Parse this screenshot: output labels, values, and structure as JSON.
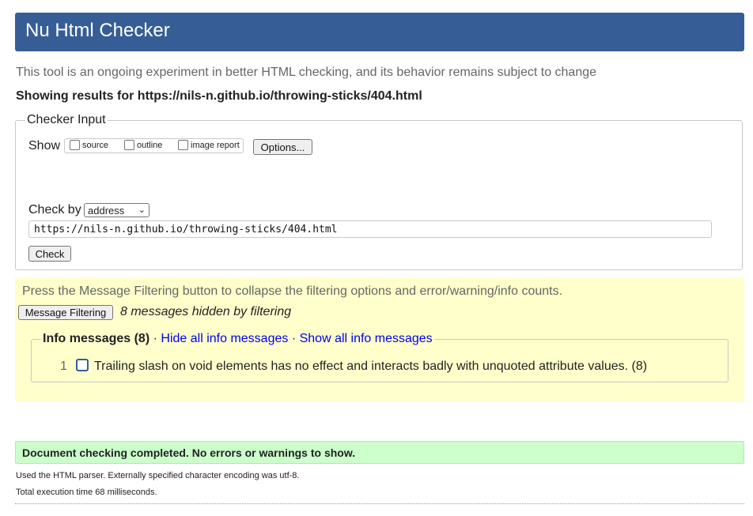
{
  "header": {
    "title": "Nu Html Checker"
  },
  "tagline": "This tool is an ongoing experiment in better HTML checking, and its behavior remains subject to change",
  "showing": "Showing results for https://nils-n.github.io/throwing-sticks/404.html",
  "checker_input": {
    "legend": "Checker Input",
    "show_label": "Show",
    "show_options": [
      "source",
      "outline",
      "image report"
    ],
    "options_button": "Options...",
    "check_by_label": "Check by",
    "check_by_selected": "address",
    "url_value": "https://nils-n.github.io/throwing-sticks/404.html",
    "check_button": "Check"
  },
  "filtering": {
    "hint": "Press the Message Filtering button to collapse the filtering options and error/warning/info counts.",
    "button": "Message Filtering",
    "hidden_text": "8 messages hidden by filtering",
    "info": {
      "legend_title": "Info messages (8)",
      "separator": "·",
      "hide_link": "Hide all info messages",
      "show_link": "Show all info messages",
      "messages": [
        {
          "number": "1",
          "text": "Trailing slash on void elements has no effect and interacts badly with unquoted attribute values. (8)"
        }
      ]
    }
  },
  "result": {
    "success": "Document checking completed. No errors or warnings to show.",
    "parser_note": "Used the HTML parser. Externally specified character encoding was utf-8.",
    "execution_time": "Total execution time 68 milliseconds."
  },
  "colors": {
    "header_bg": "#365d95",
    "filter_bg": "#ffffcc",
    "success_bg": "#ccffcc",
    "link": "#0000ee"
  }
}
